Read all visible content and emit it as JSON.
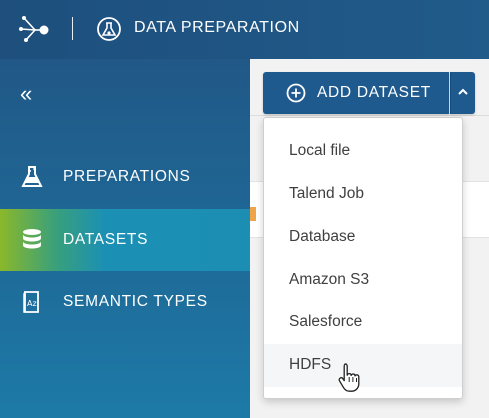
{
  "header": {
    "logo_icon": "network-node-icon",
    "app_icon": "data-prep-icon",
    "title": "DATA PREPARATION"
  },
  "sidebar": {
    "collapse_label": "«",
    "items": [
      {
        "label": "PREPARATIONS",
        "icon": "flask-icon",
        "active": false
      },
      {
        "label": "DATASETS",
        "icon": "database-icon",
        "active": true
      },
      {
        "label": "SEMANTIC TYPES",
        "icon": "dictionary-icon",
        "active": false
      }
    ]
  },
  "toolbar": {
    "add_dataset_label": "ADD DATASET",
    "add_icon": "plus-circle-icon",
    "toggle_icon": "chevron-up-icon"
  },
  "dropdown": {
    "items": [
      {
        "label": "Local file"
      },
      {
        "label": "Talend Job"
      },
      {
        "label": "Database"
      },
      {
        "label": "Amazon S3"
      },
      {
        "label": "Salesforce"
      },
      {
        "label": "HDFS",
        "hovered": true
      }
    ]
  },
  "colors": {
    "header": "#1f5483",
    "sidebar": "#1e6a98",
    "active_nav": "#1c8eb3",
    "accent_green": "#8bb82a",
    "button": "#1f5a8f"
  }
}
